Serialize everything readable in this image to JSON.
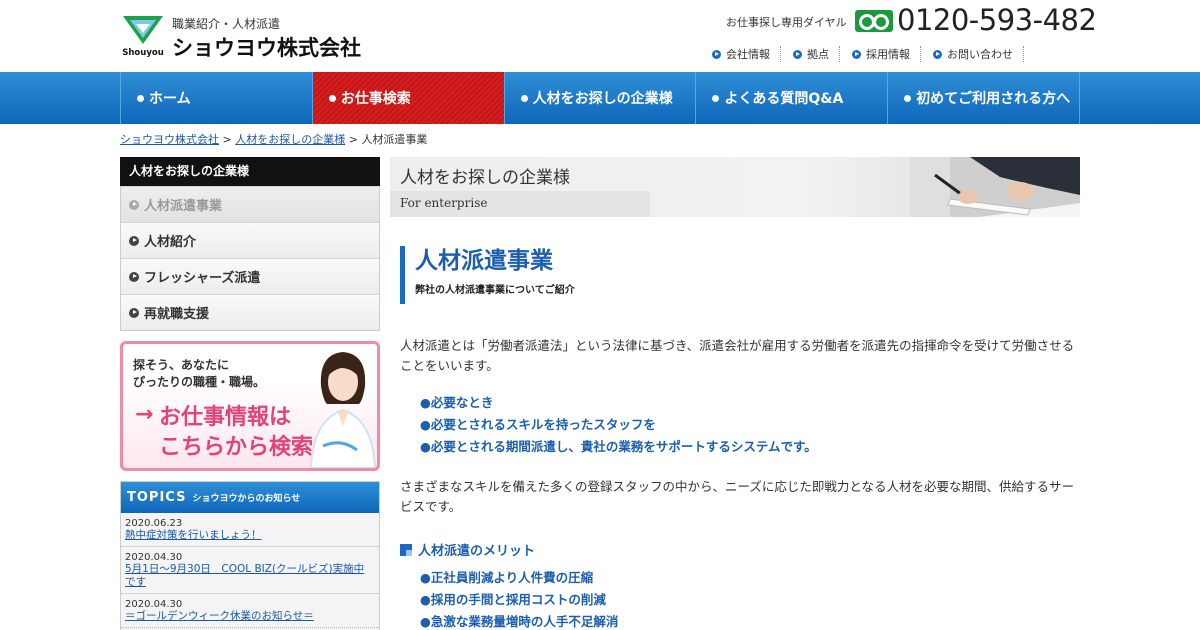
{
  "header": {
    "logo_brand": "Shouyou",
    "logo_sub": "職業紹介・人材派遣",
    "logo_main": "ショウヨウ株式会社",
    "dial_label": "お仕事探し専用ダイヤル",
    "phone": "0120-593-482",
    "util_nav": [
      "会社情報",
      "拠点",
      "採用情報",
      "お問い合わせ"
    ]
  },
  "gnav": {
    "items": [
      "ホーム",
      "お仕事検索",
      "人材をお探しの企業様",
      "よくある質問Q&A",
      "初めてご利用される方へ"
    ],
    "active_index": 1
  },
  "breadcrumb": {
    "home": "ショウヨウ株式会社",
    "sep": " > ",
    "parent": "人材をお探しの企業様",
    "current": "人材派遣事業"
  },
  "sidebar": {
    "heading": "人材をお探しの企業様",
    "items": [
      "人材派遣事業",
      "人材紹介",
      "フレッシャーズ派遣",
      "再就職支援"
    ]
  },
  "job_banner": {
    "line1": "探そう、あなたに",
    "line2": "ぴったりの職種・職場。",
    "arrow": "→",
    "big1": "お仕事情報は",
    "big2": "こちらから検索！"
  },
  "topics": {
    "title": "TOPICS",
    "subtitle": "ショウヨウからのお知らせ",
    "items": [
      {
        "date": "2020.06.23",
        "title": "熱中症対策を行いましょう！"
      },
      {
        "date": "2020.04.30",
        "title": "5月1日～9月30日　COOL BIZ(クールビズ)実施中です"
      },
      {
        "date": "2020.04.30",
        "title": "＝ゴールデンウィーク休業のお知らせ＝"
      }
    ]
  },
  "hero": {
    "title": "人材をお探しの企業様",
    "subtitle": "For enterprise"
  },
  "main": {
    "heading": "人材派遣事業",
    "heading_sub": "弊社の人材派遣事業についてご紹介",
    "para1": "人材派遣とは「労働者派遣法」という法律に基づき、派遣会社が雇用する労働者を派遣先の指揮命令を受けて労働させることをいいます。",
    "bullets": [
      "●必要なとき",
      "●必要とされるスキルを持ったスタッフを",
      "●必要とされる期間派遣し、貴社の業務をサポートするシステムです。"
    ],
    "para2": "さまざまなスキルを備えた多くの登録スタッフの中から、ニーズに応じた即戦力となる人材を必要な期間、供給するサービスです。",
    "merit_heading": "人材派遣のメリット",
    "merits": [
      "●正社員削減より人件費の圧縮",
      "●採用の手間と採用コストの削減",
      "●急激な業務量増時の人手不足解消"
    ]
  },
  "colors": {
    "brand_blue": "#1d6bbf",
    "nav_active_red": "#d42020",
    "accent_pink": "#e0457a",
    "freedial_green": "#1a9a3c"
  }
}
